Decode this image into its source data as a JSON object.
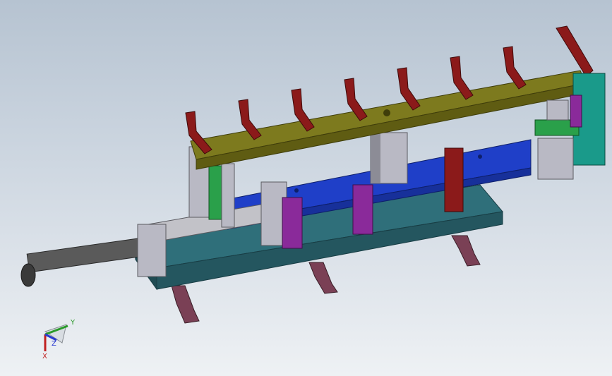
{
  "viewport": {
    "background_top": "#b6c3d1",
    "background_bottom": "#eef1f4"
  },
  "colors": {
    "rail": "#7d7a1e",
    "fingers": "#8b1a1a",
    "slide": "#1f3fc8",
    "base_plate": "#2f6f7a",
    "legs": "#7a4055",
    "cylinder": "#5a5a5a",
    "block_grey": "#b9b9c4",
    "bracket_green": "#2aa04a",
    "bracket_teal": "#1a9a8a",
    "magenta": "#8a2a9a"
  },
  "triad": {
    "y_label": "Y",
    "z_label": "Z",
    "x_label": "X",
    "y_color": "#2a9a2a",
    "z_color": "#2a3ad0",
    "x_color": "#c02020"
  }
}
